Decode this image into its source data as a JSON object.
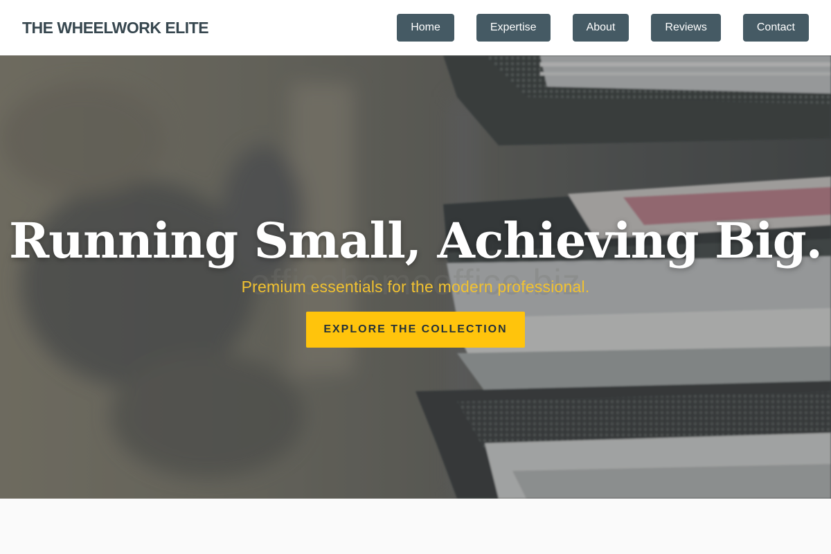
{
  "brand": {
    "name": "THE WHEELWORK ELITE"
  },
  "nav": {
    "items": [
      {
        "label": "Home"
      },
      {
        "label": "Expertise"
      },
      {
        "label": "About"
      },
      {
        "label": "Reviews"
      },
      {
        "label": "Contact"
      }
    ]
  },
  "hero": {
    "title": "Running Small, Achieving Big.",
    "subtitle": "Premium essentials for the modern professional.",
    "watermark": "officehomeoffice.biz",
    "cta_label": "EXPLORE THE COLLECTION"
  },
  "colors": {
    "nav_button_bg": "#455a64",
    "brand_text": "#37474f",
    "accent": "#ffc40c",
    "subtitle": "#f2c230"
  }
}
